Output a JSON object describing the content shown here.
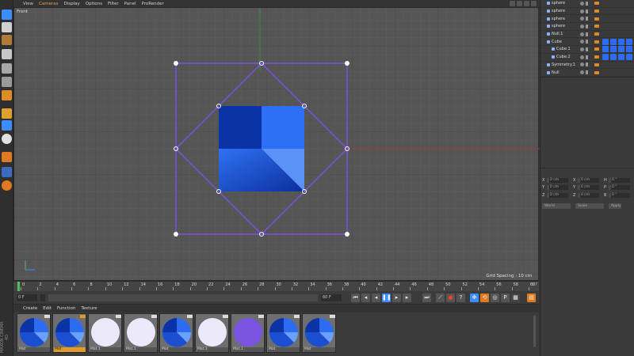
{
  "app": {
    "brand_vertical": "MAXON CINEMA 4D"
  },
  "viewport": {
    "menu": [
      "View",
      "Cameras",
      "Display",
      "Options",
      "Filter",
      "Panel",
      "ProRender"
    ],
    "camera_label": "Front",
    "grid_spacing": "Grid Spacing : 10 cm"
  },
  "object_manager": {
    "objects": [
      {
        "name": "sphere",
        "indent": 0,
        "materials": 0
      },
      {
        "name": "sphere",
        "indent": 0,
        "materials": 0
      },
      {
        "name": "sphere",
        "indent": 0,
        "materials": 0
      },
      {
        "name": "sphere",
        "indent": 0,
        "materials": 0
      },
      {
        "name": "Null.1",
        "indent": 0,
        "materials": 0
      },
      {
        "name": "Cube",
        "indent": 0,
        "materials": 4
      },
      {
        "name": "Cube.1",
        "indent": 1,
        "materials": 4
      },
      {
        "name": "Cube.2",
        "indent": 1,
        "materials": 4
      },
      {
        "name": "Symmetry.1",
        "indent": 0,
        "materials": 0
      },
      {
        "name": "Null",
        "indent": 0,
        "materials": 0
      }
    ]
  },
  "coordinates": {
    "rows": [
      [
        {
          "axis": "X",
          "value": "0 cm"
        },
        {
          "axis": "X",
          "value": "0 cm"
        },
        {
          "axis": "H",
          "value": "0 °"
        }
      ],
      [
        {
          "axis": "Y",
          "value": "0 cm"
        },
        {
          "axis": "Y",
          "value": "0 cm"
        },
        {
          "axis": "P",
          "value": "0 °"
        }
      ],
      [
        {
          "axis": "Z",
          "value": "0 cm"
        },
        {
          "axis": "Z",
          "value": "0 cm"
        },
        {
          "axis": "B",
          "value": "0 °"
        }
      ]
    ],
    "mode_dropdown": "World",
    "size_dropdown": "Scale",
    "apply_button": "Apply"
  },
  "timeline": {
    "ticks": [
      "0",
      "2",
      "4",
      "6",
      "8",
      "10",
      "12",
      "14",
      "16",
      "18",
      "20",
      "22",
      "24",
      "26",
      "28",
      "30",
      "32",
      "34",
      "36",
      "38",
      "40",
      "42",
      "44",
      "46",
      "48",
      "50",
      "52",
      "54",
      "56",
      "58",
      "60"
    ],
    "current_frame": "0 F"
  },
  "transport": {
    "start_field": "0 F",
    "min_field": "0 F",
    "max_field": "60 F",
    "end_field": "60 F"
  },
  "material_manager": {
    "menu": [
      "Create",
      "Edit",
      "Function",
      "Texture"
    ],
    "materials": [
      {
        "name": "Mat",
        "swatch": "blue",
        "selected": false
      },
      {
        "name": "Mat",
        "swatch": "blue",
        "selected": true
      },
      {
        "name": "Mat.1",
        "swatch": "white",
        "selected": false
      },
      {
        "name": "Mat.1",
        "swatch": "white",
        "selected": false
      },
      {
        "name": "Mat",
        "swatch": "blue",
        "selected": false
      },
      {
        "name": "Mat.1",
        "swatch": "white",
        "selected": false
      },
      {
        "name": "Mat.1",
        "swatch": "purple",
        "selected": false
      },
      {
        "name": "Mat",
        "swatch": "blue",
        "selected": false
      },
      {
        "name": "Mat",
        "swatch": "blue",
        "selected": false
      }
    ]
  },
  "colors": {
    "cube_blue": "#2b6cf0",
    "cube_dark": "#0a33a6",
    "outline_purple": "#7a54e0",
    "accent_orange": "#e09a2a",
    "playhead_green": "#4fc05a"
  }
}
